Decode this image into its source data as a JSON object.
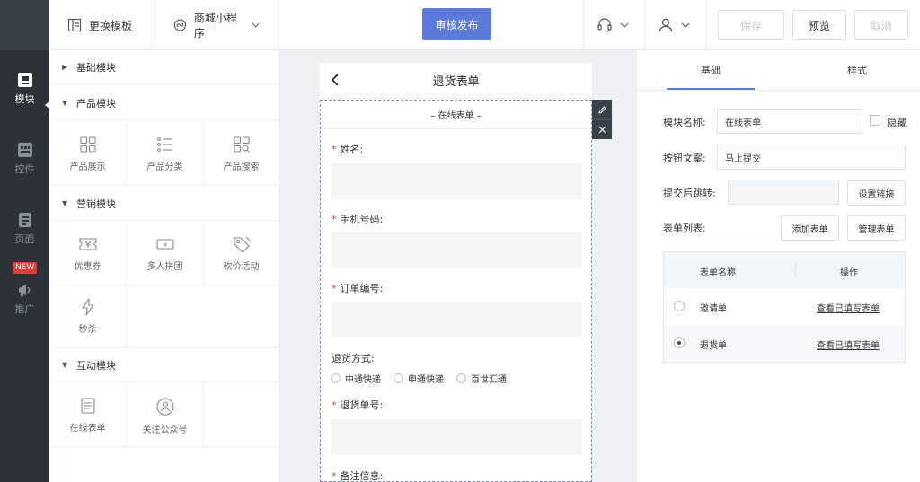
{
  "rail": {
    "items": [
      {
        "label": "模块",
        "icon": "module-icon",
        "active": true
      },
      {
        "label": "控件",
        "icon": "widget-icon",
        "active": false
      },
      {
        "label": "页面",
        "icon": "page-icon",
        "active": false
      },
      {
        "label": "推广",
        "icon": "promote-icon",
        "active": false
      }
    ],
    "new_badge": "NEW"
  },
  "topbar": {
    "change_template": "更换模板",
    "app_type": "商城小程序",
    "publish": "审核发布",
    "save": "保存",
    "preview": "预览",
    "cancel": "取消"
  },
  "modules": {
    "basic": "基础模块",
    "product": "产品模块",
    "product_items": [
      "产品展示",
      "产品分类",
      "产品搜索"
    ],
    "marketing": "营销模块",
    "marketing_items": [
      "优惠券",
      "多人拼团",
      "砍价活动",
      "秒杀"
    ],
    "interactive": "互动模块",
    "interactive_items": [
      "在线表单",
      "关注公众号"
    ]
  },
  "phone": {
    "title": "退货表单",
    "form_heading": "– 在线表单 –",
    "fields": {
      "name": "姓名:",
      "phone": "手机号码:",
      "order": "订单编号:",
      "return_method": "退货方式:",
      "return_no": "退货单号:",
      "remark": "备注信息:"
    },
    "required_mark": "*",
    "radio_options": [
      "中通快递",
      "申通快递",
      "百世汇通"
    ]
  },
  "right": {
    "tab_basic": "基础",
    "tab_style": "样式",
    "module_name_label": "模块名称:",
    "module_name_value": "在线表单",
    "hide_label": "隐藏",
    "button_text_label": "按钮文案:",
    "button_text_value": "马上提交",
    "redirect_label": "提交后跳转:",
    "set_link": "设置链接",
    "form_list_label": "表单列表:",
    "add_form": "添加表单",
    "manage_form": "管理表单",
    "table": {
      "col_name": "表单名称",
      "col_action": "操作",
      "rows": [
        {
          "name": "邀请单",
          "action": "查看已填写表单",
          "selected": false
        },
        {
          "name": "退货单",
          "action": "查看已填写表单",
          "selected": true
        }
      ]
    }
  },
  "colors": {
    "accent": "#5b7bd8",
    "rail_bg": "#2d3239",
    "required": "#e23b3b"
  }
}
